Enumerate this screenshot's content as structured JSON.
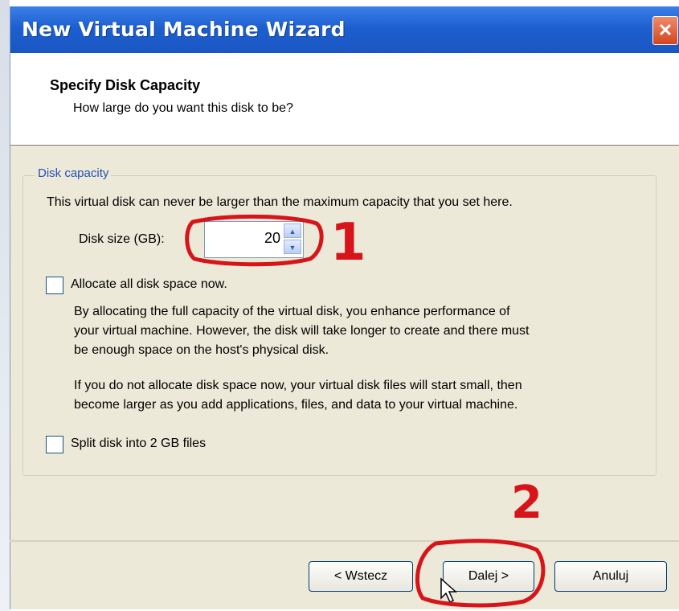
{
  "window": {
    "title": "New Virtual Machine Wizard",
    "close_glyph": "✕"
  },
  "header": {
    "title": "Specify Disk Capacity",
    "subtitle": "How large do you want this disk to be?"
  },
  "group": {
    "legend": "Disk capacity",
    "description": "This virtual disk can never be larger than the maximum capacity that you set here.",
    "size_label": "Disk size (GB):",
    "size_value": "20"
  },
  "allocate": {
    "label": "Allocate all disk space now.",
    "checked": false,
    "para1_line1": "By allocating the full capacity of the virtual disk, you enhance performance of",
    "para1_line2": "your virtual machine.  However, the disk will take longer to create and there must",
    "para1_line3": "be enough space on the host's physical disk.",
    "para2_line1": "If you do not allocate disk space now, your virtual disk files will start small, then",
    "para2_line2": "become larger as you add applications, files, and data to your virtual machine."
  },
  "split": {
    "label": "Split disk into 2 GB files",
    "checked": false
  },
  "buttons": {
    "back": "< Wstecz",
    "next": "Dalej >",
    "cancel": "Anuluj"
  },
  "annotations": {
    "marker1": "1",
    "marker2": "2",
    "color": "#d7141a"
  }
}
